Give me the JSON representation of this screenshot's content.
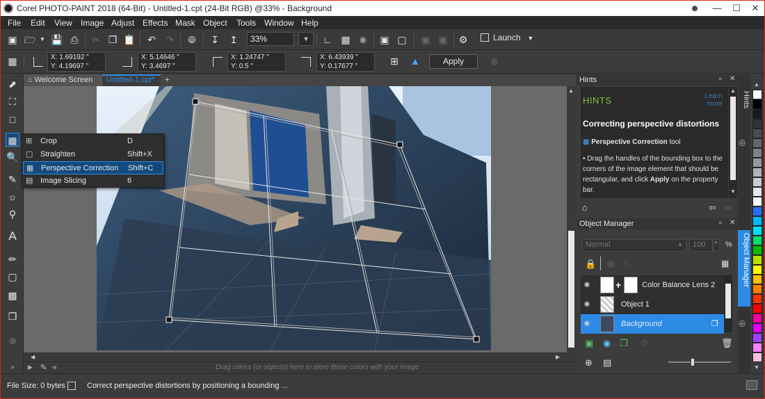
{
  "window": {
    "title": "Corel PHOTO-PAINT 2018 (64-Bit) - Untitled-1.cpt (24-Bit RGB) @33% - Background"
  },
  "menu": [
    "File",
    "Edit",
    "View",
    "Image",
    "Adjust",
    "Effects",
    "Mask",
    "Object",
    "Tools",
    "Window",
    "Help"
  ],
  "toolbar": {
    "zoom_value": "33%",
    "launch_label": "Launch"
  },
  "propbar": {
    "node1": {
      "x": "1.69192 \"",
      "y": "4.19697 \""
    },
    "node2": {
      "x": "5.14646 \"",
      "y": "3.4697 \""
    },
    "node3": {
      "x": "1.24747 \"",
      "y": "0.5 \""
    },
    "node4": {
      "x": "6.43939 \"",
      "y": "0.17677 \""
    },
    "x_label": "X:",
    "y_label": "Y:",
    "apply_label": "Apply"
  },
  "tabs": {
    "welcome": "Welcome Screen",
    "document": "Untitled-1.cpt*",
    "add": "+"
  },
  "flyout": {
    "items": [
      {
        "label": "Crop",
        "shortcut": "D",
        "icon": "crop-icon"
      },
      {
        "label": "Straighten",
        "shortcut": "Shift+X",
        "icon": "straighten-icon"
      },
      {
        "label": "Perspective Correction",
        "shortcut": "Shift+C",
        "icon": "perspective-correction-icon"
      },
      {
        "label": "Image Slicing",
        "shortcut": "6",
        "icon": "image-slicing-icon"
      }
    ],
    "selected_index": 2
  },
  "colorbar": {
    "hint": "Drag colors (or objects) here to store these colors with your image"
  },
  "status": {
    "file_size": "File Size: 0 bytes",
    "message": "Correct perspective distortions by positioning a bounding ..."
  },
  "hints": {
    "panel_title": "Hints",
    "heading": "HINTS",
    "learn_more": "Learn more",
    "title": "Correcting perspective distortions",
    "tool_name": "Perspective Correction",
    "tool_suffix": " tool",
    "body_pre": "• Drag the handles of the bounding box to the corners of the image element that should be rectangular, and click ",
    "body_bold": "Apply",
    "body_post": " on the property bar.",
    "vtab": "Hints"
  },
  "object_manager": {
    "panel_title": "Object Manager",
    "blend_mode": "Normal",
    "opacity": "100",
    "percent": "%",
    "layers": [
      {
        "name": "Color Balance Lens 2",
        "selected": false
      },
      {
        "name": "Object 1",
        "selected": false
      },
      {
        "name": "Background",
        "selected": true
      }
    ],
    "vtab": "Object Manager"
  },
  "palette_colors": [
    "#ffffff",
    "#000000",
    "#1a1a1a",
    "#333333",
    "#4d4d4d",
    "#666666",
    "#808080",
    "#999999",
    "#b3b3b3",
    "#cccccc",
    "#e6e6e6",
    "#ffffff",
    "#2b6cff",
    "#00b7ff",
    "#00e0ff",
    "#00e070",
    "#00c000",
    "#b8e000",
    "#ffff00",
    "#ffc000",
    "#ff8000",
    "#ff3000",
    "#ff0000",
    "#ff00a0",
    "#e000ff",
    "#a040ff",
    "#ff80ff",
    "#ffc0e0"
  ]
}
